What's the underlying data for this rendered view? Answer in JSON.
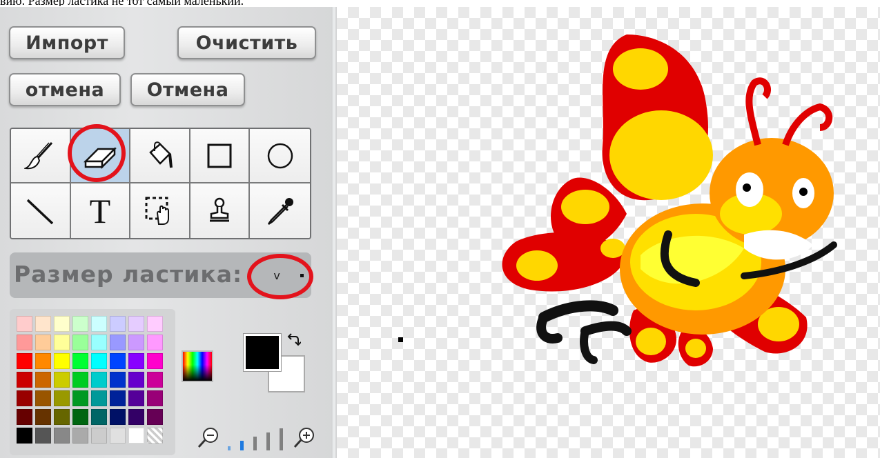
{
  "top_text": "вию. Размер ластика не тот самый маленький.",
  "buttons": {
    "import": "Импорт",
    "clear": "Очистить",
    "undo": "отмена",
    "redo": "Отмена"
  },
  "tools": [
    {
      "name": "paintbrush-tool",
      "icon": "paintbrush-icon"
    },
    {
      "name": "eraser-tool",
      "icon": "eraser-icon",
      "selected": true
    },
    {
      "name": "fill-tool",
      "icon": "paint-bucket-icon"
    },
    {
      "name": "rectangle-tool",
      "icon": "square-icon"
    },
    {
      "name": "ellipse-tool",
      "icon": "circle-icon"
    },
    {
      "name": "line-tool",
      "icon": "line-icon"
    },
    {
      "name": "text-tool",
      "icon": "text-t-icon",
      "glyph": "T"
    },
    {
      "name": "select-tool",
      "icon": "select-hand-icon"
    },
    {
      "name": "stamp-tool",
      "icon": "stamp-icon"
    },
    {
      "name": "eyedropper-tool",
      "icon": "eyedropper-icon"
    }
  ],
  "size_panel": {
    "label": "Размер ластика:",
    "dropdown_glyph": "v"
  },
  "palette": {
    "rows": [
      [
        "#ffcccc",
        "#ffe5cc",
        "#ffffcc",
        "#ccffcc",
        "#ccffff",
        "#ccccff",
        "#e5ccff",
        "#ffccff"
      ],
      [
        "#ff9999",
        "#ffcc99",
        "#ffff99",
        "#99ff99",
        "#99ffff",
        "#9999ff",
        "#cc99ff",
        "#ff99ff"
      ],
      [
        "#ff0000",
        "#ff8800",
        "#ffff00",
        "#00ff33",
        "#00ffff",
        "#0044ff",
        "#8800ff",
        "#ff00cc"
      ],
      [
        "#cc0000",
        "#cc6600",
        "#cccc00",
        "#00cc22",
        "#00cccc",
        "#0033cc",
        "#6600cc",
        "#cc0099"
      ],
      [
        "#990000",
        "#995500",
        "#999900",
        "#009922",
        "#009999",
        "#002299",
        "#550099",
        "#990077"
      ],
      [
        "#660000",
        "#663300",
        "#666600",
        "#006611",
        "#006666",
        "#001166",
        "#330066",
        "#660055"
      ],
      [
        "#000000",
        "#555555",
        "#888888",
        "#aaaaaa",
        "#cccccc",
        "#e0e0e0",
        "#ffffff",
        "transparent"
      ]
    ],
    "foreground": "#000000",
    "background": "#ffffff"
  },
  "zoom": {
    "levels": 5,
    "active": 2
  },
  "highlight_color": "#e3131c"
}
